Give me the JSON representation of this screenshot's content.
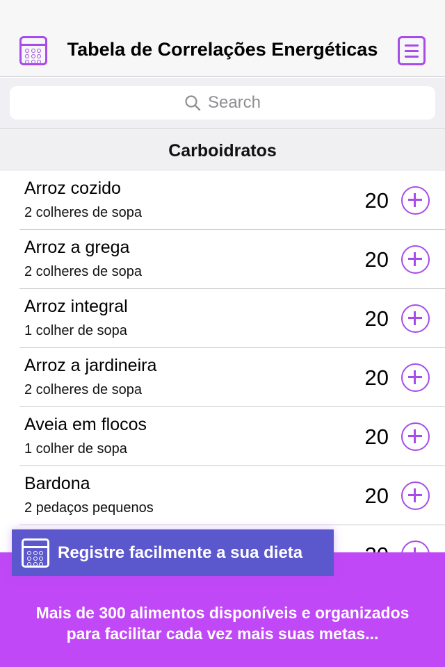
{
  "navbar": {
    "title": "Tabela de Correlações Energéticas",
    "left_icon": "calendar-icon",
    "right_icon": "list-menu-icon",
    "accent_color": "#a64ce8"
  },
  "search": {
    "placeholder": "Search",
    "icon": "search-icon"
  },
  "section": {
    "title": "Carboidratos"
  },
  "items": [
    {
      "name": "Arroz cozido",
      "portion": "2 colheres de sopa",
      "value": "20"
    },
    {
      "name": "Arroz a grega",
      "portion": "2 colheres de sopa",
      "value": "20"
    },
    {
      "name": "Arroz integral",
      "portion": "1 colher de sopa",
      "value": "20"
    },
    {
      "name": "Arroz a jardineira",
      "portion": "2 colheres de sopa",
      "value": "20"
    },
    {
      "name": "Aveia em flocos",
      "portion": "1 colher de sopa",
      "value": "20"
    },
    {
      "name": "Bardona",
      "portion": "2 pedaços pequenos",
      "value": "20"
    },
    {
      "name": "",
      "portion": "",
      "value": "20"
    }
  ],
  "promo": {
    "banner_label": "Registre facilmente a sua dieta",
    "banner_icon": "calendar-icon",
    "description_line1": "Mais de 300 alimentos disponíveis e organizados",
    "description_line2": "para facilitar cada vez mais suas metas...",
    "band_color": "#c148f7",
    "banner_color": "#5b57cc"
  }
}
